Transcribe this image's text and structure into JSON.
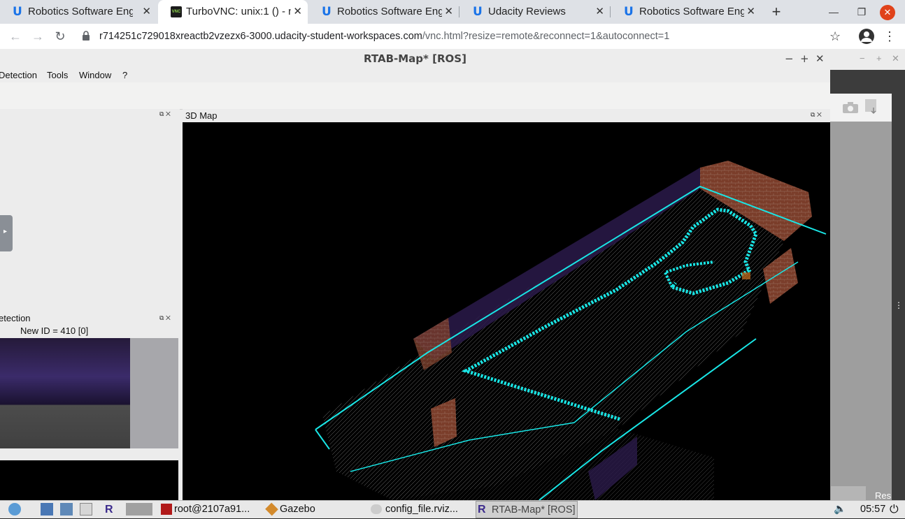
{
  "browser": {
    "tabs": [
      {
        "title": "Robotics Software Eng",
        "icon": "udacity-icon",
        "active": false
      },
      {
        "title": "TurboVNC: unix:1 () - n",
        "icon": "vnc-icon",
        "active": true
      },
      {
        "title": "Robotics Software Eng",
        "icon": "udacity-icon",
        "active": false
      },
      {
        "title": "Udacity Reviews",
        "icon": "udacity-icon",
        "active": false
      },
      {
        "title": "Robotics Software Eng",
        "icon": "udacity-icon",
        "active": false
      }
    ],
    "tab_close_glyph": "✕",
    "new_tab_glyph": "+",
    "url_host": "r714251c729018xreactb2vzezx6-3000.udacity-student-workspaces.com",
    "url_path": "/vnc.html?resize=remote&reconnect=1&autoconnect=1",
    "window_controls": {
      "minimize": "—",
      "restore": "❐",
      "close": "✕"
    },
    "nav": {
      "back": "←",
      "forward": "→",
      "reload": "↻",
      "star": "☆",
      "menu": "⋮"
    }
  },
  "rtabmap": {
    "title": "RTAB-Map* [ROS]",
    "controls": {
      "minimize": "−",
      "maximize": "+",
      "close": "✕"
    },
    "menus": [
      "Detection",
      "Tools",
      "Window",
      "?"
    ],
    "left_dock": {
      "loop_header": "etection",
      "new_id_label": "New ID = 410 [0]"
    },
    "map_panel": {
      "title": "3D Map",
      "float_glyph": "⧉",
      "close_glyph": "✕"
    }
  },
  "right_window": {
    "controls": {
      "minimize": "−",
      "maximize": "+",
      "close": "✕"
    },
    "partial_label": "Res"
  },
  "taskbar": {
    "items": [
      {
        "label": "root@2107a91...",
        "icon": "terminal-icon"
      },
      {
        "label": "Gazebo",
        "icon": "gazebo-icon"
      },
      {
        "label": "config_file.rviz...",
        "icon": "rviz-icon"
      },
      {
        "label": "RTAB-Map* [ROS]",
        "icon": "rtabmap-icon"
      }
    ],
    "clock": "05:57",
    "launcher_letter": "R"
  },
  "colors": {
    "trajectory": "#19e6e6",
    "map_background": "#000000",
    "point_cloud": "#bbbbbb",
    "udacity_blue": "#1a73e8"
  }
}
